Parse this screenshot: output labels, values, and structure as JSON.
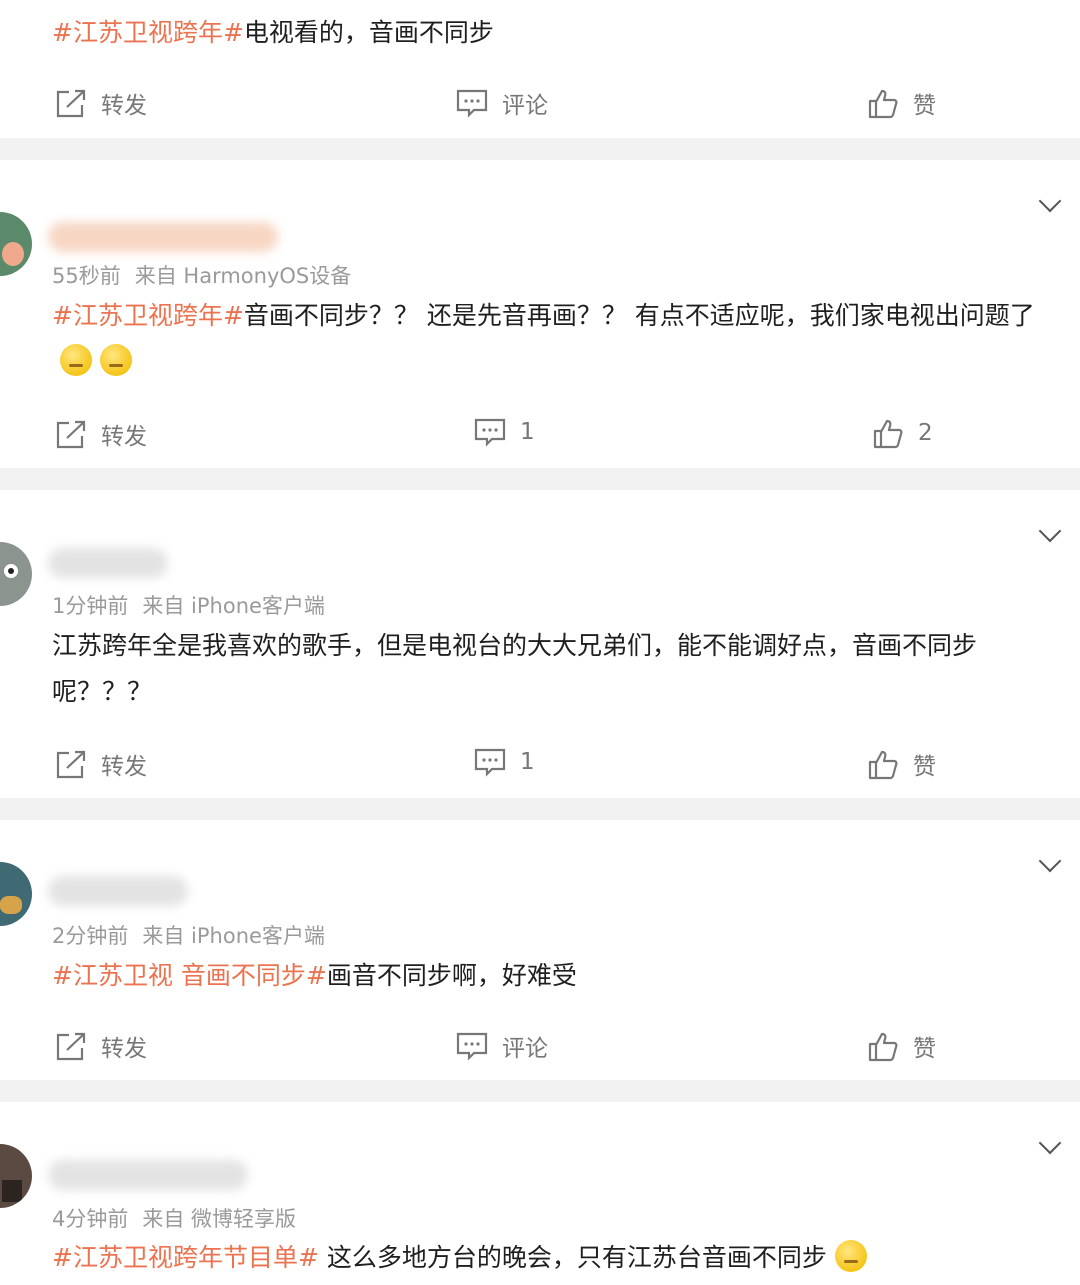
{
  "actions": {
    "repost": "转发",
    "comment": "评论",
    "like": "赞"
  },
  "posts": [
    {
      "tag": "#江苏卫视跨年#",
      "body": "电视看的，音画不同步",
      "comment_label": "评论",
      "like_label": "赞"
    },
    {
      "meta_time": "55秒前",
      "meta_from": "来自 HarmonyOS设备",
      "tag": "#江苏卫视跨年#",
      "body": "音画不同步？？ 还是先音再画？？ 有点不适应呢，我们家电视出问题了",
      "emoji_count": 2,
      "comment_label": "1",
      "like_label": "2"
    },
    {
      "meta_time": "1分钟前",
      "meta_from": "来自 iPhone客户端",
      "tag": "",
      "body": "江苏跨年全是我喜欢的歌手，但是电视台的大大兄弟们，能不能调好点，音画不同步呢？？？",
      "comment_label": "1",
      "like_label": "赞"
    },
    {
      "meta_time": "2分钟前",
      "meta_from": "来自 iPhone客户端",
      "tag": "#江苏卫视 音画不同步#",
      "body": "画音不同步啊，好难受",
      "comment_label": "评论",
      "like_label": "赞"
    },
    {
      "meta_time": "4分钟前",
      "meta_from": "来自 微博轻享版",
      "tag": "#江苏卫视跨年节目单#",
      "body": " 这么多地方台的晚会，只有江苏台音画不同步",
      "emoji_count": 1
    }
  ],
  "colors": {
    "tag": "#eb7350",
    "background": "#f2f2f2",
    "text": "#1f1f1f",
    "meta": "#9a9a9a"
  }
}
